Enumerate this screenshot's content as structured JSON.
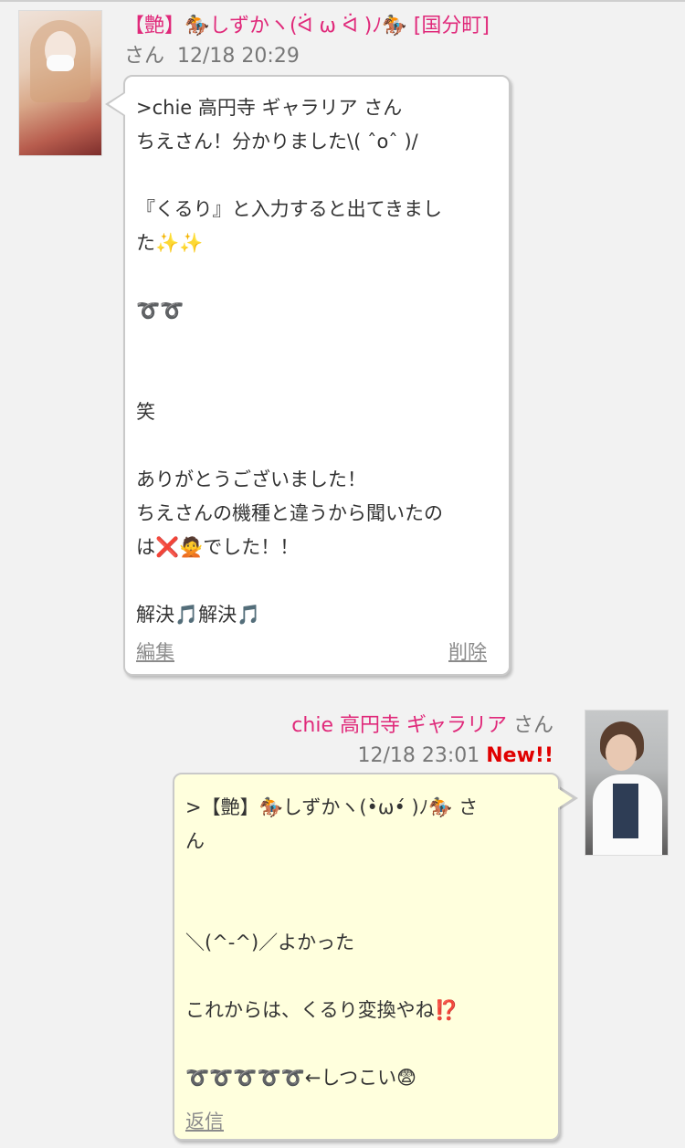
{
  "post1": {
    "name": "【艶】🏇しずかヽ(ᐛ ω ᐛ )ﾉ🏇 [国分町]",
    "san": "さん",
    "time": "12/18 20:29",
    "lines": [
      ">chie 高円寺 ギャラリア さん",
      "ちえさん！分かりました\\( ˆoˆ )/",
      "",
      "『くるり』と入力すると出てきまし",
      "た✨✨",
      "",
      "➰➰",
      "",
      "",
      "笑",
      "",
      "ありがとうございました！",
      "ちえさんの機種と違うから聞いたの",
      "は❌🙅でした！！",
      "",
      "解決🎵解決🎵"
    ],
    "edit": "編集",
    "delete": "削除"
  },
  "post2": {
    "name": "chie 高円寺 ギャラリア",
    "san": "さん",
    "time": "12/18 23:01",
    "new": "New!!",
    "lines": [
      ">【艶】🏇しずかヽ(•̀ω•́ )ﾉ🏇 さ",
      "ん",
      "",
      "",
      "＼(^-^)／よかった",
      "",
      "これからは、くるり変換やね⁉️",
      "",
      "➰➰➰➰➰←しつこい😨"
    ],
    "reply": "返信"
  }
}
